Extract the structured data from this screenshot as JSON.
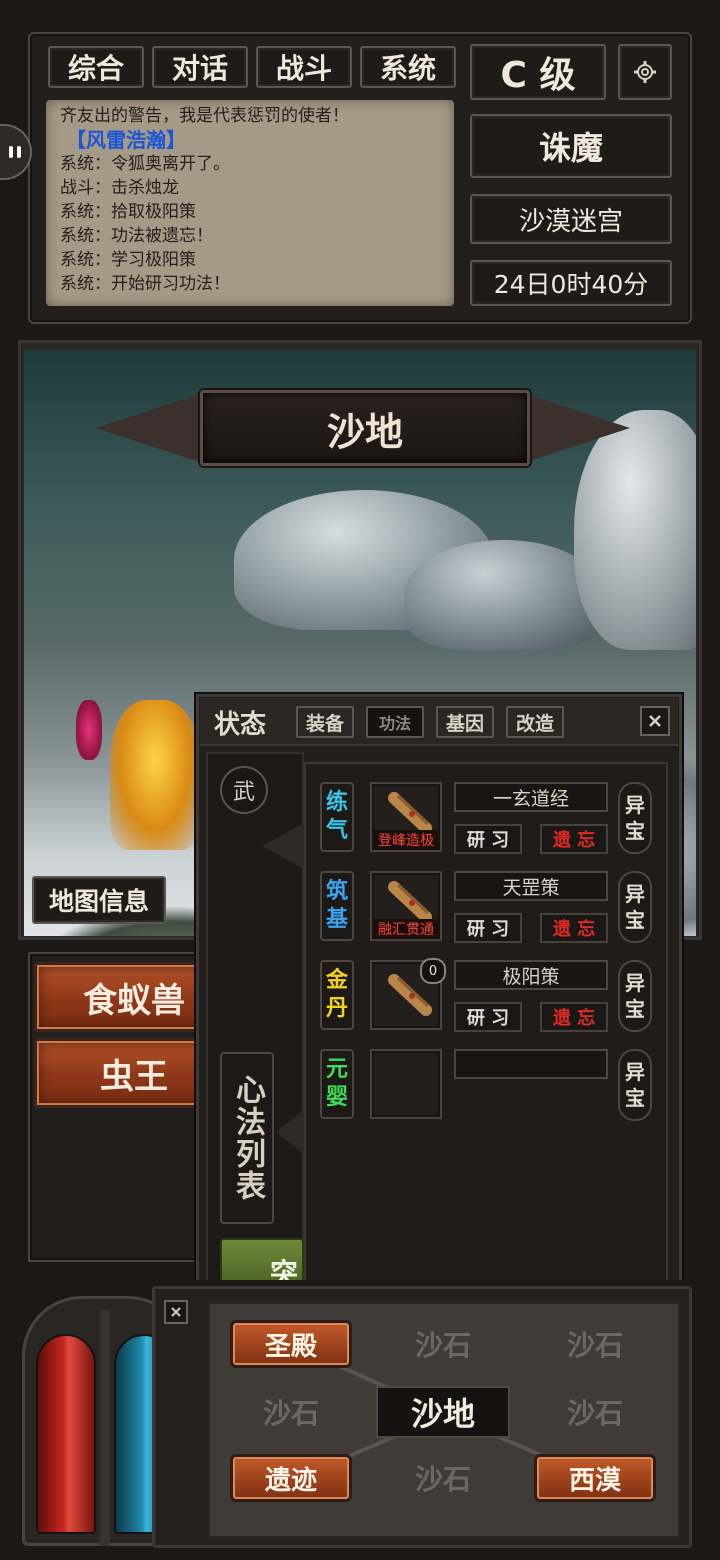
{
  "tabs": [
    "综合",
    "对话",
    "战斗",
    "系统"
  ],
  "grade": "C 级",
  "log_lines": [
    {
      "text": "齐友出的警告，我是代表惩罚的使者！",
      "highlight": false
    },
    {
      "text": "【风雷浩瀚】",
      "highlight": true
    },
    {
      "text": "系统：令狐奥离开了。",
      "highlight": false
    },
    {
      "text": "战斗：击杀烛龙",
      "highlight": false
    },
    {
      "text": "系统：拾取极阳策",
      "highlight": false
    },
    {
      "text": "系统：功法被遗忘！",
      "highlight": false
    },
    {
      "text": "系统：学习极阳策",
      "highlight": false
    },
    {
      "text": "系统：开始研习功法！",
      "highlight": false
    }
  ],
  "info": {
    "mode": "诛魔",
    "map": "沙漠迷宫",
    "time": "24日0时40分"
  },
  "scene": {
    "title": "沙地",
    "map_info": "地图信息"
  },
  "monsters": [
    "食蚁兽",
    "虫王"
  ],
  "skill_panel": {
    "tab_status": "状态",
    "tabs": [
      "装备",
      "功法",
      "基因",
      "改造"
    ],
    "active_tab": "功法",
    "wu_badge": "武",
    "list_label": "心法列表",
    "side_btn_fragment": "突",
    "rows": [
      {
        "stage": "练气",
        "color": "#38c7e8",
        "name": "一玄道经",
        "level": "登峰造极",
        "study": "研 习",
        "forget": "遗 忘",
        "treasure": "异宝",
        "count": ""
      },
      {
        "stage": "筑基",
        "color": "#3aa3f0",
        "name": "天罡策",
        "level": "融汇贯通",
        "study": "研 习",
        "forget": "遗 忘",
        "treasure": "异宝",
        "count": ""
      },
      {
        "stage": "金丹",
        "color": "#f3d21c",
        "name": "极阳策",
        "level": "",
        "study": "研 习",
        "forget": "遗 忘",
        "treasure": "异宝",
        "count": "0"
      },
      {
        "stage": "元婴",
        "color": "#3fdc56",
        "name": "",
        "level": "",
        "study": "",
        "forget": "",
        "treasure": "异宝",
        "count": ""
      }
    ]
  },
  "nav": {
    "cells": [
      {
        "label": "圣殿",
        "active": true
      },
      {
        "label": "沙石",
        "active": false
      },
      {
        "label": "沙石",
        "active": false
      },
      {
        "label": "沙石",
        "active": false
      },
      {
        "label": "沙地",
        "active": false,
        "current": true
      },
      {
        "label": "沙石",
        "active": false
      },
      {
        "label": "遗迹",
        "active": true
      },
      {
        "label": "沙石",
        "active": false
      },
      {
        "label": "西漠",
        "active": true
      }
    ]
  },
  "colors": {
    "hp": "#c3261f",
    "mp": "#1f87a8",
    "accent_orange": "#a84622",
    "forget_red": "#e02a22",
    "log_highlight": "#1b56d8"
  }
}
